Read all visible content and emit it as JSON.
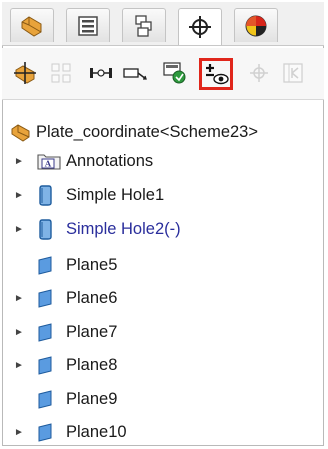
{
  "tabs": [
    {
      "icon": "part-feature-icon",
      "active": false
    },
    {
      "icon": "property-list-icon",
      "active": false
    },
    {
      "icon": "configuration-icon",
      "active": false
    },
    {
      "icon": "crosshair-icon",
      "active": true
    },
    {
      "icon": "appearance-pie-icon",
      "active": false
    }
  ],
  "toolbar": {
    "tools": [
      {
        "icon": "coordinate-system-icon",
        "enabled": true
      },
      {
        "icon": "grid-matrix-icon",
        "enabled": false
      },
      {
        "icon": "dimension-range-icon",
        "enabled": true
      },
      {
        "icon": "arrow-sketch-icon",
        "enabled": true
      },
      {
        "icon": "material-chip-icon",
        "enabled": true
      },
      {
        "icon": "show-plus-minus-icon",
        "enabled": true,
        "highlighted": true
      },
      {
        "icon": "move-crosshair-icon",
        "enabled": false
      },
      {
        "icon": "table-text-icon",
        "enabled": false
      }
    ]
  },
  "tree": {
    "root_label": "Plate_coordinate<Scheme23>",
    "items": [
      {
        "label": "Annotations",
        "icon": "annotations-icon",
        "expandable": true,
        "color": "normal"
      },
      {
        "label": "Simple Hole1",
        "icon": "hole-feature-icon",
        "expandable": true,
        "color": "normal"
      },
      {
        "label": "Simple Hole2(-)",
        "icon": "hole-feature-icon",
        "expandable": true,
        "color": "blue"
      },
      {
        "label": "Plane5",
        "icon": "plane-icon",
        "expandable": false,
        "color": "normal"
      },
      {
        "label": "Plane6",
        "icon": "plane-icon",
        "expandable": true,
        "color": "normal"
      },
      {
        "label": "Plane7",
        "icon": "plane-icon",
        "expandable": true,
        "color": "normal"
      },
      {
        "label": "Plane8",
        "icon": "plane-icon",
        "expandable": true,
        "color": "normal"
      },
      {
        "label": "Plane9",
        "icon": "plane-icon",
        "expandable": false,
        "color": "normal"
      },
      {
        "label": "Plane10",
        "icon": "plane-icon",
        "expandable": true,
        "color": "normal"
      }
    ]
  },
  "colors": {
    "highlight_border": "#e0261b",
    "blue_text": "#2a2e9c",
    "plane_blue": "#3a86d6"
  }
}
